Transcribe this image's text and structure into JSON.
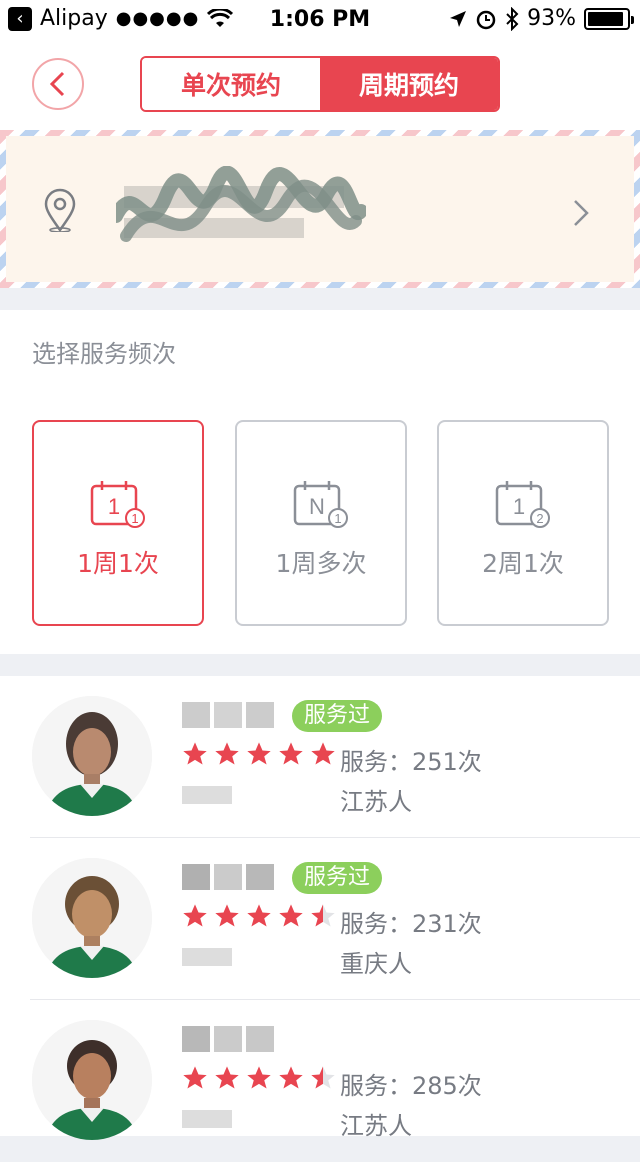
{
  "status_bar": {
    "carrier": "Alipay",
    "signal": "●●●●●",
    "time": "1:06 PM",
    "battery": "93%",
    "battery_level": 0.93
  },
  "header": {
    "tabs": [
      {
        "label": "单次预约",
        "active": false
      },
      {
        "label": "周期预约",
        "active": true
      }
    ]
  },
  "frequency": {
    "title": "选择服务频次",
    "options": [
      {
        "label": "1周1次",
        "calendar_main": "1",
        "calendar_badge": "1",
        "selected": true
      },
      {
        "label": "1周多次",
        "calendar_main": "N",
        "calendar_badge": "1",
        "selected": false
      },
      {
        "label": "2周1次",
        "calendar_main": "1",
        "calendar_badge": "2",
        "selected": false
      }
    ]
  },
  "staff": [
    {
      "badge": "服务过",
      "rating": 5,
      "service_count": "服务：251次",
      "hometown": "江苏人"
    },
    {
      "badge": "服务过",
      "rating": 4.5,
      "service_count": "服务：231次",
      "hometown": "重庆人"
    },
    {
      "badge": "",
      "rating": 4.5,
      "service_count": "服务：285次",
      "hometown": "江苏人"
    }
  ],
  "colors": {
    "accent": "#e84550",
    "badge_green": "#8ccf5c",
    "muted_text": "#8b8f97"
  }
}
